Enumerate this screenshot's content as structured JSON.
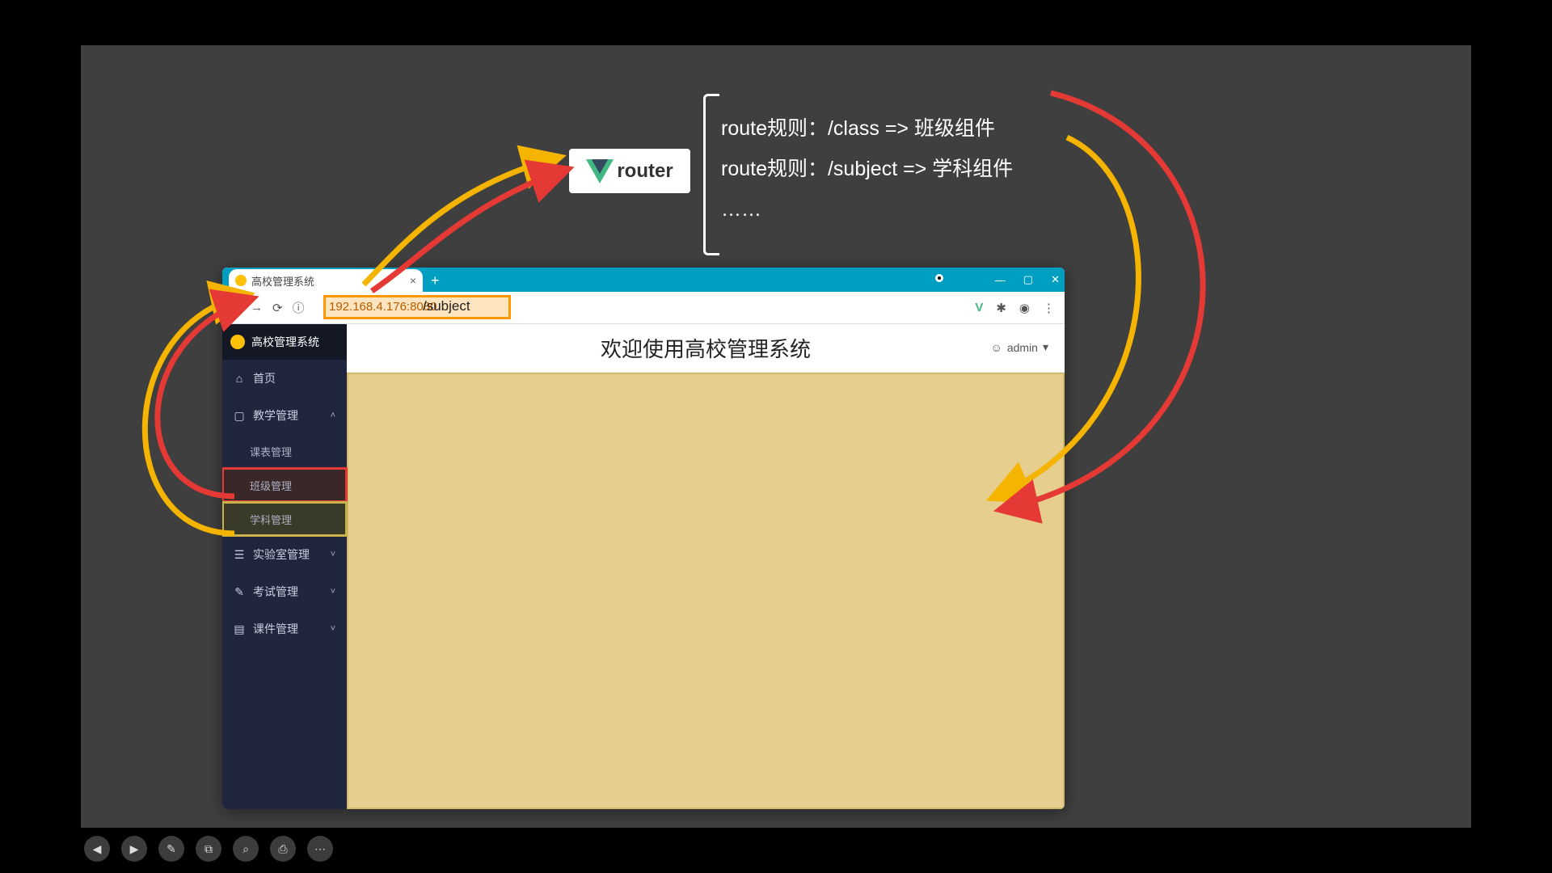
{
  "diagram": {
    "router_label": "router",
    "rules": [
      "route规则：/class => 班级组件",
      "route规则：/subject => 学科组件",
      "……"
    ]
  },
  "browser": {
    "tab_title": "高校管理系统",
    "window": {
      "min": "—",
      "max": "▢",
      "close": "✕"
    },
    "newtab": "+",
    "nav": {
      "back": "←",
      "forward": "→",
      "reload": "⟳",
      "info": "ⓘ"
    },
    "address_host": "192.168.4.176:8080",
    "address_path": "/subject",
    "ext": {
      "vue": "V",
      "puzzle": "✱",
      "user": "◉",
      "menu": "⋮"
    }
  },
  "sidebar": {
    "brand": "高校管理系统",
    "items": [
      {
        "icon": "⌂",
        "label": "首页",
        "type": "item"
      },
      {
        "icon": "▢",
        "label": "教学管理",
        "type": "group",
        "open": true
      },
      {
        "label": "课表管理",
        "type": "sub"
      },
      {
        "label": "班级管理",
        "type": "sub",
        "hl": "red"
      },
      {
        "label": "学科管理",
        "type": "sub",
        "hl": "yellow"
      },
      {
        "icon": "☰",
        "label": "实验室管理",
        "type": "group"
      },
      {
        "icon": "✎",
        "label": "考试管理",
        "type": "group"
      },
      {
        "icon": "▤",
        "label": "课件管理",
        "type": "group"
      }
    ]
  },
  "header": {
    "title": "欢迎使用高校管理系统",
    "user": "admin",
    "user_caret": "▾"
  },
  "player": {
    "buttons": [
      "◀",
      "▶",
      "✎",
      "⧉",
      "⌕",
      "⎙",
      "⋯"
    ]
  }
}
